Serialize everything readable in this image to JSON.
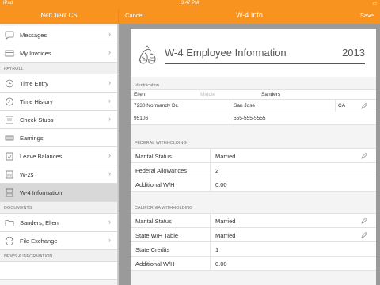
{
  "status_bar": {
    "device": "iPad",
    "time": "3:47 PM",
    "battery": "▭"
  },
  "sidebar": {
    "title": "NetClient CS",
    "items_top": [
      {
        "label": "Messages",
        "icon": "chat-bubble-icon"
      },
      {
        "label": "My Invoices",
        "icon": "invoice-icon"
      }
    ],
    "payroll_header": "PAYROLL",
    "payroll_items": [
      {
        "label": "Time Entry",
        "icon": "clock-icon"
      },
      {
        "label": "Time History",
        "icon": "clock-history-icon"
      },
      {
        "label": "Check Stubs",
        "icon": "check-stub-icon"
      },
      {
        "label": "Earnings",
        "icon": "earnings-icon"
      },
      {
        "label": "Leave Balances",
        "icon": "leave-icon"
      },
      {
        "label": "W-2s",
        "icon": "w2-document-icon"
      },
      {
        "label": "W-4 Information",
        "icon": "w4-document-icon",
        "selected": true
      }
    ],
    "documents_header": "DOCUMENTS",
    "document_items": [
      {
        "label": "Sanders, Ellen",
        "icon": "folder-icon"
      },
      {
        "label": "File Exchange",
        "icon": "exchange-icon"
      }
    ],
    "news_header": "NEWS & INFORMATION"
  },
  "nav": {
    "title": "W-4 Info",
    "cancel": "Cancel",
    "save": "Save"
  },
  "form": {
    "title": "W-4 Employee Information",
    "year": "2013",
    "identification": {
      "label": "Identification",
      "first_name": "Ellen",
      "middle_placeholder": "Middle",
      "last_name": "Sanders",
      "address": "7230 Normandy Dr.",
      "city": "San Jose",
      "state": "CA",
      "zip": "95106",
      "phone": "555-555-5555"
    },
    "federal": {
      "label": "FEDERAL WITHHOLDING",
      "rows": [
        {
          "key": "Marital Status",
          "value": "Married",
          "editable": true
        },
        {
          "key": "Federal Allowances",
          "value": "2"
        },
        {
          "key": "Additional W/H",
          "value": "0.00"
        }
      ]
    },
    "california": {
      "label": "CALIFORNIA WITHHOLDING",
      "rows": [
        {
          "key": "Marital Status",
          "value": "Married",
          "editable": true
        },
        {
          "key": "State W/H Table",
          "value": "Married",
          "editable": true
        },
        {
          "key": "State Credits",
          "value": "1"
        },
        {
          "key": "Additional W/H",
          "value": "0.00"
        }
      ]
    }
  },
  "colors": {
    "accent": "#f7931e",
    "selected_row": "#d8d8d8",
    "background": "#9a9a9a"
  }
}
